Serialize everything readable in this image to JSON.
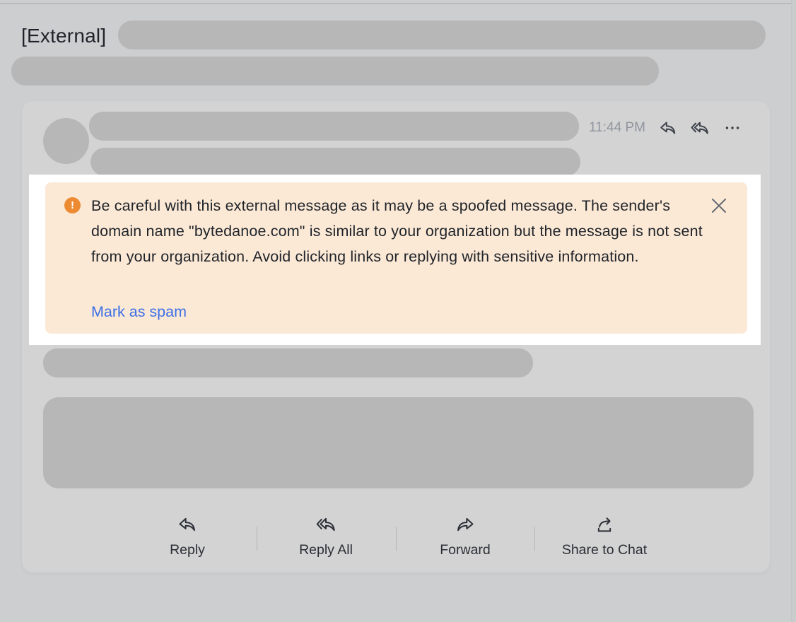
{
  "header": {
    "subject_tag": "[External]"
  },
  "message": {
    "time": "11:44 PM",
    "header_actions": [
      {
        "name": "reply",
        "icon": "reply-icon"
      },
      {
        "name": "reply-all",
        "icon": "reply-all-icon"
      },
      {
        "name": "more",
        "icon": "more-icon"
      }
    ]
  },
  "warning_banner": {
    "icon": "warning-icon",
    "icon_glyph": "!",
    "text": "Be careful with this external message as it may be a spoofed message. The sender's domain name \"bytedanoe.com\" is similar to your organization but the message is not sent from your organization. Avoid clicking links or replying with sensitive information.",
    "action_label": "Mark as spam",
    "close_icon": "close-icon",
    "colors": {
      "background": "#fbe9d6",
      "icon": "#ed8b32",
      "link": "#3c6fe6"
    }
  },
  "footer_actions": [
    {
      "label": "Reply",
      "icon": "reply-icon"
    },
    {
      "label": "Reply All",
      "icon": "reply-all-icon"
    },
    {
      "label": "Forward",
      "icon": "forward-icon"
    },
    {
      "label": "Share to Chat",
      "icon": "share-icon"
    }
  ]
}
